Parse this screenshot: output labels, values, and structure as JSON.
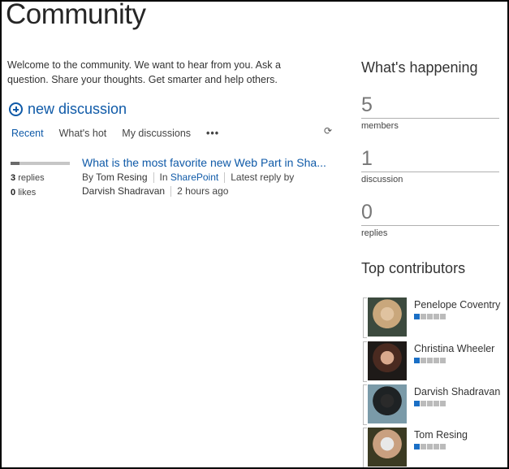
{
  "page": {
    "title": "Community",
    "welcome": "Welcome to the community. We want to hear from you. Ask a question. Share your thoughts. Get smarter and help others."
  },
  "actions": {
    "new_discussion": "new discussion",
    "new_discussion_icon": "plus-circle-icon",
    "refresh_icon": "refresh-icon"
  },
  "tabs": [
    {
      "label": "Recent",
      "active": true
    },
    {
      "label": "What's hot",
      "active": false
    },
    {
      "label": "My discussions",
      "active": false
    }
  ],
  "tabs_more": "•••",
  "refresh_glyph": "⟳",
  "discussions": [
    {
      "title": "What is the most favorite new Web Part in Sha...",
      "popularity": 0.15,
      "replies_count": "3",
      "replies_label": "replies",
      "likes_count": "0",
      "likes_label": "likes",
      "by_label": "By",
      "author": "Tom Resing",
      "in_label": "In",
      "category": "SharePoint",
      "latest_label": "Latest reply by",
      "latest_author": "Darvish Shadravan",
      "time": "2 hours ago"
    }
  ],
  "happening": {
    "title": "What's happening",
    "stats": [
      {
        "value": "5",
        "label": "members"
      },
      {
        "value": "1",
        "label": "discussion"
      },
      {
        "value": "0",
        "label": "replies"
      }
    ]
  },
  "contributors": {
    "title": "Top contributors",
    "level_max": 5,
    "people": [
      {
        "name": "Penelope Coventry",
        "level": 1,
        "avatar_colors": [
          "#3c4a3e",
          "#c9a77c",
          "#e0c3a0"
        ]
      },
      {
        "name": "Christina Wheeler",
        "level": 1,
        "avatar_colors": [
          "#1e1a18",
          "#4a2a20",
          "#d9a98d"
        ]
      },
      {
        "name": "Darvish Shadravan",
        "level": 1,
        "avatar_colors": [
          "#7a9aa8",
          "#1e2224",
          "#2a2a2a"
        ]
      },
      {
        "name": "Tom Resing",
        "level": 1,
        "avatar_colors": [
          "#3b3a22",
          "#c9a080",
          "#e8e8e8"
        ]
      }
    ]
  },
  "colors": {
    "accent": "#0f5aa8",
    "level_on": "#1a6fc5",
    "level_off": "#bbbbbb"
  }
}
